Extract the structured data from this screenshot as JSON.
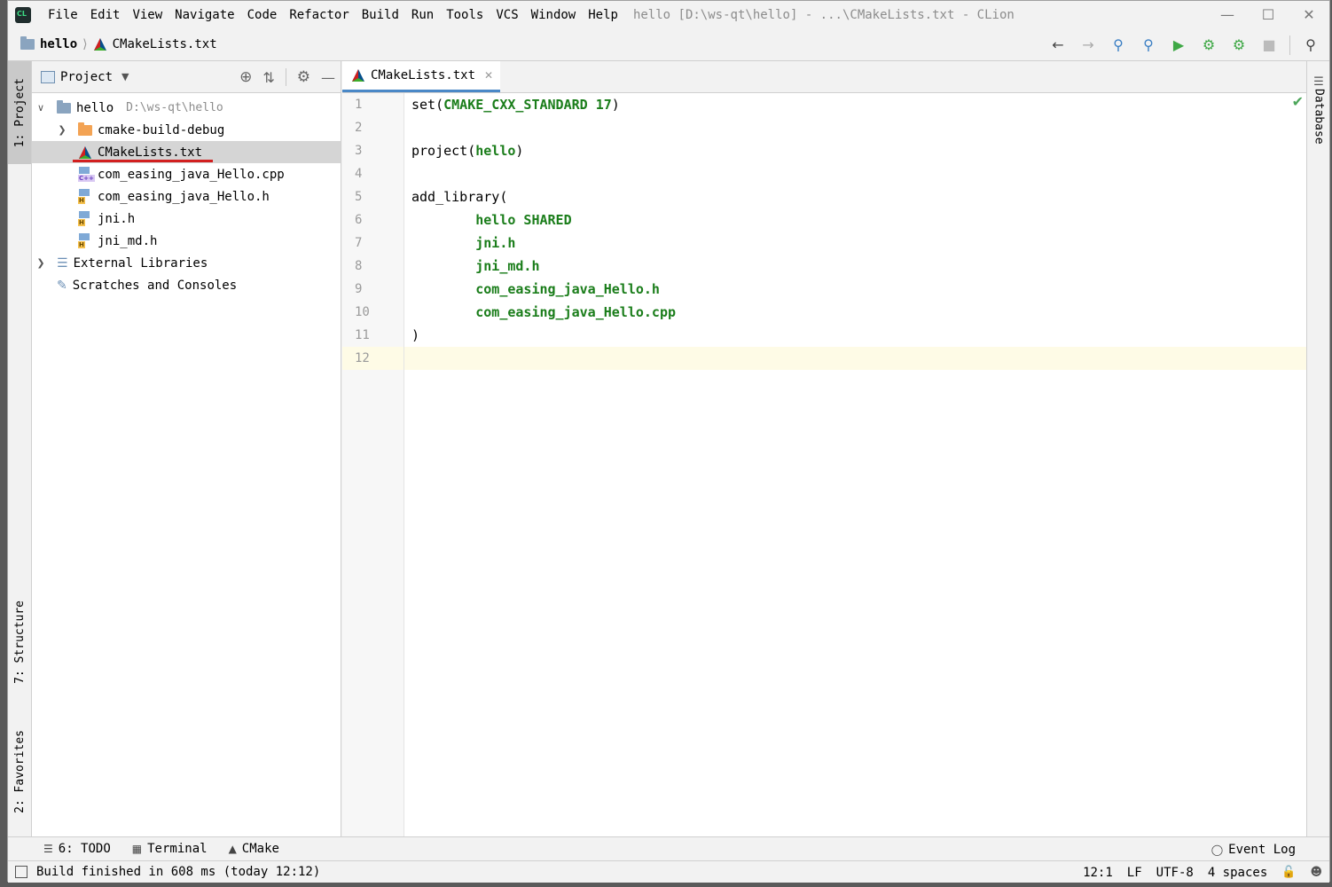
{
  "titlebar": {
    "menus": [
      "File",
      "Edit",
      "View",
      "Navigate",
      "Code",
      "Refactor",
      "Build",
      "Run",
      "Tools",
      "VCS",
      "Window",
      "Help"
    ],
    "window_title": "hello [D:\\ws-qt\\hello] - ...\\CMakeLists.txt - CLion"
  },
  "navbar": {
    "project": "hello",
    "file": "CMakeLists.txt"
  },
  "project_panel": {
    "title": "Project",
    "tree": [
      {
        "label": "hello",
        "path": "D:\\ws-qt\\hello"
      },
      {
        "label": "cmake-build-debug"
      },
      {
        "label": "CMakeLists.txt"
      },
      {
        "label": "com_easing_java_Hello.cpp"
      },
      {
        "label": "com_easing_java_Hello.h"
      },
      {
        "label": "jni.h"
      },
      {
        "label": "jni_md.h"
      },
      {
        "label": "External Libraries"
      },
      {
        "label": "Scratches and Consoles"
      }
    ]
  },
  "left_strip": {
    "project": "1: Project",
    "structure": "7: Structure",
    "favorites": "2: Favorites"
  },
  "right_strip": {
    "database": "Database"
  },
  "editor": {
    "tab": "CMakeLists.txt",
    "line_numbers": [
      "1",
      "2",
      "3",
      "4",
      "5",
      "6",
      "7",
      "8",
      "9",
      "10",
      "11",
      "12"
    ],
    "current_line": 12,
    "lines": [
      {
        "plain": "set(",
        "arg": "CMAKE_CXX_STANDARD 17",
        "end": ")"
      },
      {
        "plain": ""
      },
      {
        "plain": "project(",
        "arg": "hello",
        "end": ")"
      },
      {
        "plain": ""
      },
      {
        "plain": "add_library("
      },
      {
        "plain": "        ",
        "arg": "hello SHARED"
      },
      {
        "plain": "        ",
        "arg": "jni.h"
      },
      {
        "plain": "        ",
        "arg": "jni_md.h"
      },
      {
        "plain": "        ",
        "arg": "com_easing_java_Hello.h"
      },
      {
        "plain": "        ",
        "arg": "com_easing_java_Hello.cpp"
      },
      {
        "plain": ")"
      },
      {
        "plain": ""
      }
    ]
  },
  "bottom_tabs": {
    "todo": "6: TODO",
    "terminal": "Terminal",
    "cmake": "CMake",
    "event_log": "Event Log"
  },
  "statusbar": {
    "message": "Build finished in 608 ms (today 12:12)",
    "position": "12:1",
    "line_sep": "LF",
    "encoding": "UTF-8",
    "indent": "4 spaces"
  },
  "colors": {
    "accent_tab": "#4a88c7",
    "cmake_arg": "#1a7d1a",
    "selection": "#d5d5d5",
    "current_line": "#fefbe6",
    "annotation_underline": "#d21f1f"
  }
}
